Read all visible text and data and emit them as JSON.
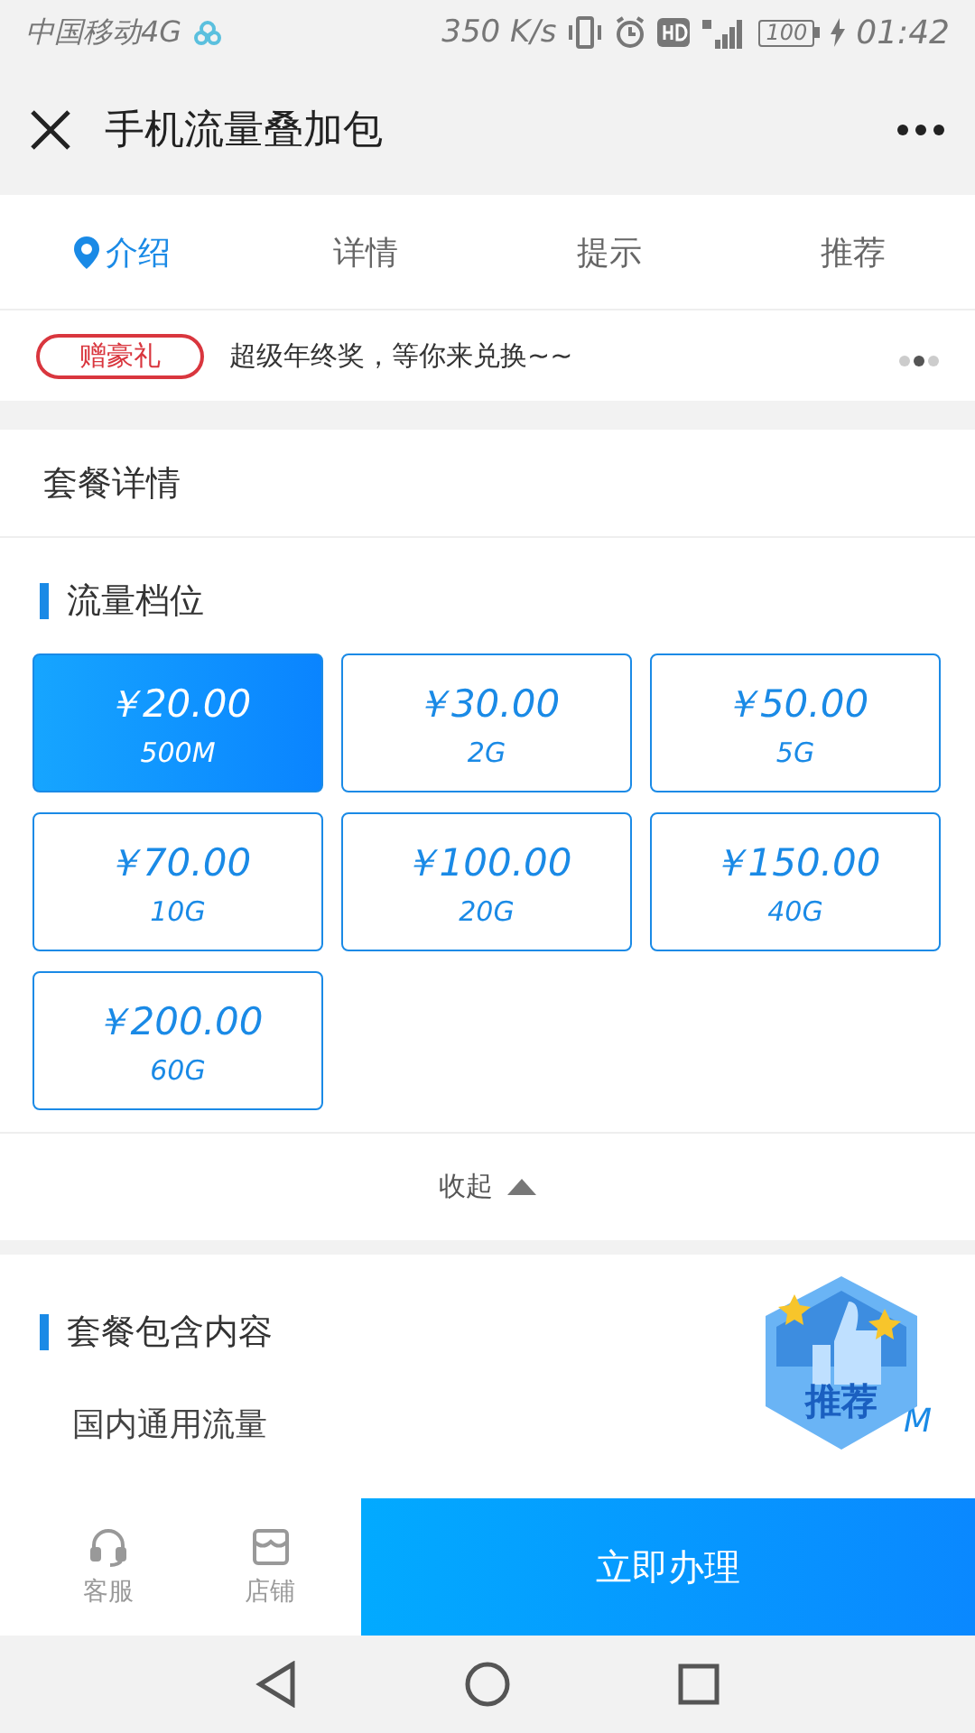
{
  "status_bar": {
    "carrier": "中国移动4G",
    "speed": "350 K/s",
    "battery": "100",
    "time": "01:42"
  },
  "header": {
    "title": "手机流量叠加包"
  },
  "tabs": [
    {
      "label": "介绍",
      "selected": true
    },
    {
      "label": "详情",
      "selected": false
    },
    {
      "label": "提示",
      "selected": false
    },
    {
      "label": "推荐",
      "selected": false
    }
  ],
  "promo": {
    "tag": "赠豪礼",
    "text": "超级年终奖，等你来兑换~~",
    "pages": [
      {
        "selected": false
      },
      {
        "selected": true
      },
      {
        "selected": false
      }
    ]
  },
  "details": {
    "title": "套餐详情",
    "tier_heading": "流量档位",
    "tiers": [
      {
        "price": "￥20.00",
        "data": "500M",
        "selected": true
      },
      {
        "price": "￥30.00",
        "data": "2G",
        "selected": false
      },
      {
        "price": "￥50.00",
        "data": "5G",
        "selected": false
      },
      {
        "price": "￥70.00",
        "data": "10G",
        "selected": false
      },
      {
        "price": "￥100.00",
        "data": "20G",
        "selected": false
      },
      {
        "price": "￥150.00",
        "data": "40G",
        "selected": false
      },
      {
        "price": "￥200.00",
        "data": "60G",
        "selected": false
      }
    ],
    "collapse": "收起"
  },
  "contents": {
    "heading": "套餐包含内容",
    "rows": [
      {
        "label": "国内通用流量",
        "value": "M"
      }
    ]
  },
  "recommend_badge": "推荐",
  "bottom_bar": {
    "actions": [
      {
        "kind": "service",
        "label": "客服"
      },
      {
        "kind": "shop",
        "label": "店铺"
      }
    ],
    "primary": "立即办理"
  }
}
